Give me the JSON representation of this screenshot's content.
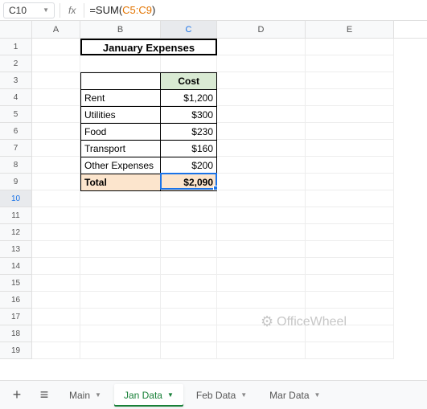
{
  "formula_bar": {
    "cell_ref": "C10",
    "fx_label": "fx",
    "formula_prefix": "=SUM(",
    "formula_range": "C5:C9",
    "formula_suffix": ")"
  },
  "columns": [
    "A",
    "B",
    "C",
    "D",
    "E"
  ],
  "title": "January Expenses",
  "headers": {
    "blank": "",
    "cost": "Cost"
  },
  "rows": [
    {
      "label": "Rent",
      "value": "$1,200"
    },
    {
      "label": "Utilities",
      "value": "$300"
    },
    {
      "label": "Food",
      "value": "$230"
    },
    {
      "label": "Transport",
      "value": "$160"
    },
    {
      "label": "Other Expenses",
      "value": "$200"
    }
  ],
  "total": {
    "label": "Total",
    "value": "$2,090"
  },
  "watermark": "OfficeWheel",
  "tabs": {
    "add": "+",
    "all": "≡",
    "items": [
      "Main",
      "Jan Data",
      "Feb Data",
      "Mar Data"
    ],
    "active": "Jan Data"
  },
  "chart_data": {
    "type": "table",
    "title": "January Expenses",
    "categories": [
      "Rent",
      "Utilities",
      "Food",
      "Transport",
      "Other Expenses"
    ],
    "values": [
      1200,
      300,
      230,
      160,
      200
    ],
    "total": 2090,
    "ylabel": "Cost"
  }
}
